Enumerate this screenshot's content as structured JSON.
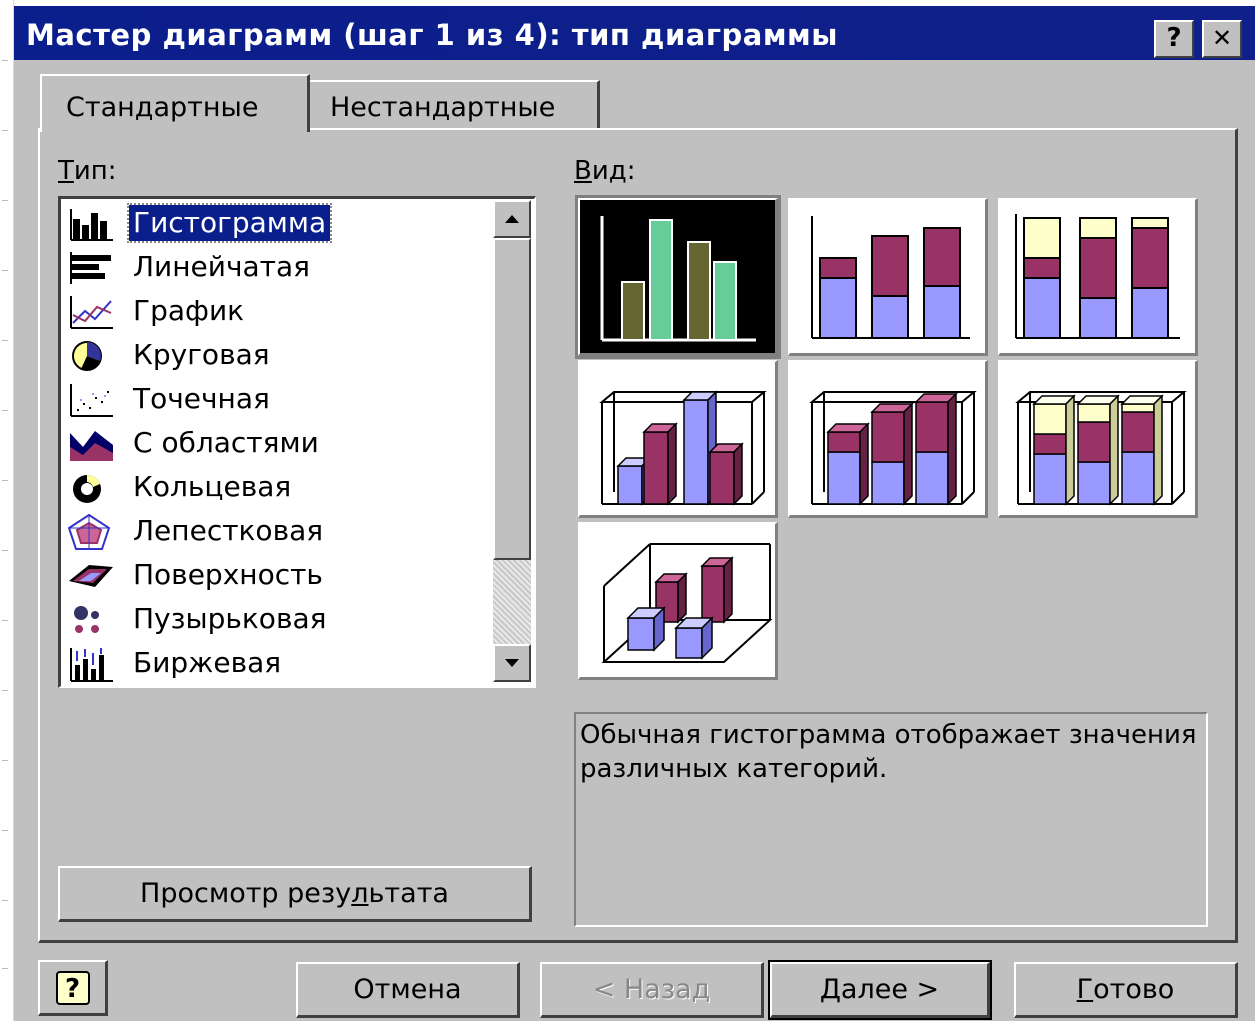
{
  "window": {
    "title": "Мастер диаграмм (шаг 1 из 4): тип диаграммы",
    "help_btn": "?",
    "close_btn": "✕"
  },
  "tabs": [
    {
      "label": "Стандартные",
      "active": true
    },
    {
      "label": "Нестандартные",
      "active": false
    }
  ],
  "type_label": {
    "accel": "Т",
    "rest": "ип:"
  },
  "view_label": {
    "accel": "В",
    "rest": "ид:"
  },
  "chart_types": [
    {
      "label": "Гистограмма",
      "icon": "column-chart-icon",
      "selected": true
    },
    {
      "label": "Линейчатая",
      "icon": "bar-chart-icon"
    },
    {
      "label": "График",
      "icon": "line-chart-icon"
    },
    {
      "label": "Круговая",
      "icon": "pie-chart-icon"
    },
    {
      "label": "Точечная",
      "icon": "scatter-chart-icon"
    },
    {
      "label": "С областями",
      "icon": "area-chart-icon"
    },
    {
      "label": "Кольцевая",
      "icon": "doughnut-chart-icon"
    },
    {
      "label": "Лепестковая",
      "icon": "radar-chart-icon"
    },
    {
      "label": "Поверхность",
      "icon": "surface-chart-icon"
    },
    {
      "label": "Пузырьковая",
      "icon": "bubble-chart-icon"
    },
    {
      "label": "Биржевая",
      "icon": "stock-chart-icon"
    }
  ],
  "subtypes": [
    {
      "name": "clustered-column",
      "selected": true
    },
    {
      "name": "stacked-column"
    },
    {
      "name": "percent-stacked-column"
    },
    {
      "name": "clustered-column-3d-effect"
    },
    {
      "name": "stacked-column-3d-effect"
    },
    {
      "name": "percent-stacked-column-3d-effect"
    },
    {
      "name": "3d-column"
    }
  ],
  "description": "Обычная гистограмма отображает значения различных категорий.",
  "preview_button": {
    "before": "Просмотр резу",
    "accel": "л",
    "after": "ьтата"
  },
  "buttons": {
    "help_icon": "?",
    "cancel": "Отмена",
    "back": "< Назад",
    "next": "Далее >",
    "finish_accel": "Г",
    "finish_rest": "отово"
  },
  "colors": {
    "title_bar": "#0a1e8c",
    "face": "#c0c0c0",
    "periwinkle": "#9999ff",
    "plum": "#993366",
    "ivory": "#ffffcc",
    "olive": "#666633",
    "seafoam": "#66cc99"
  }
}
